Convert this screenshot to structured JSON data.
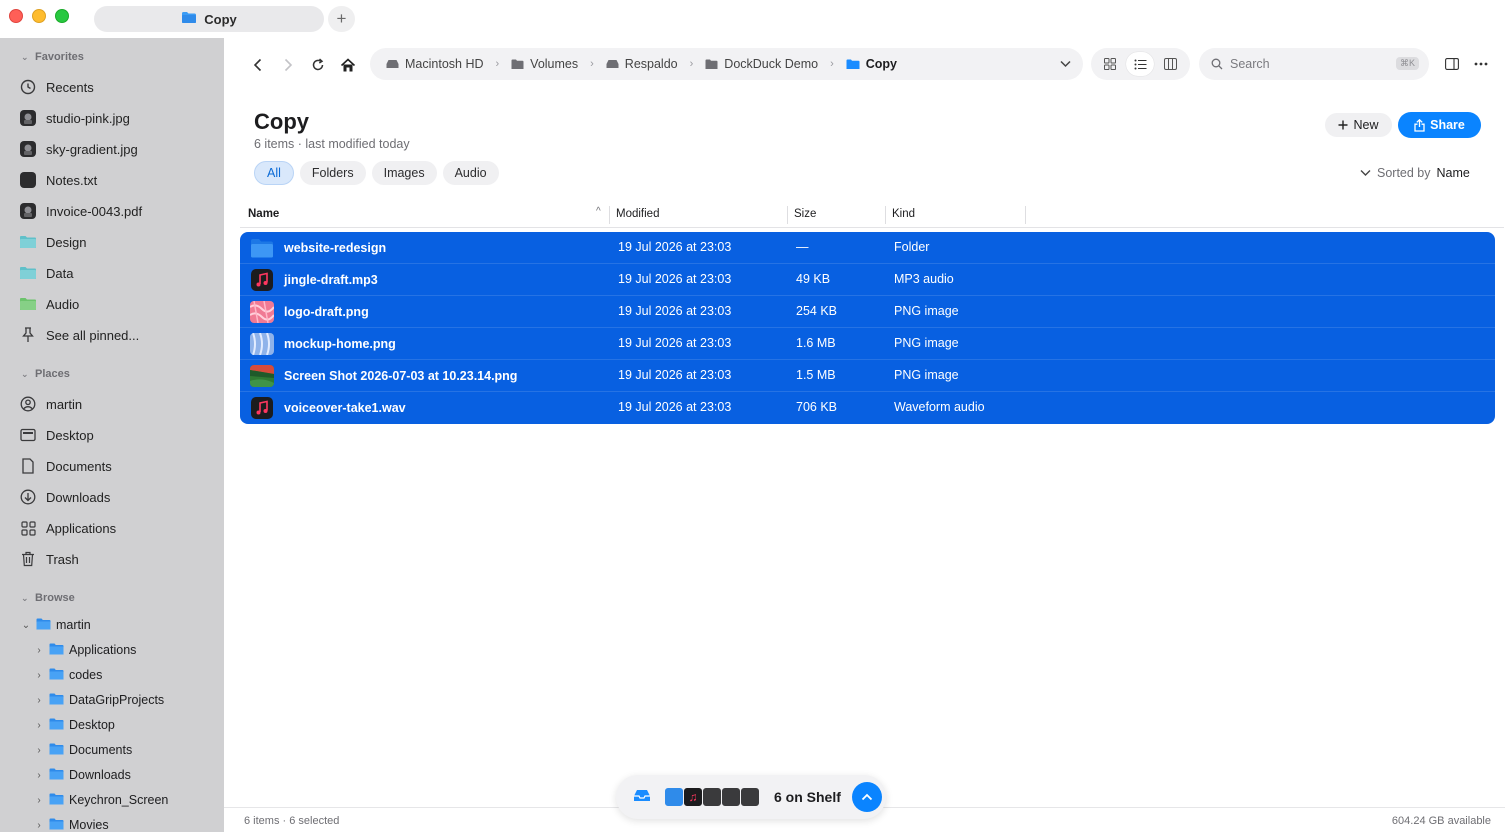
{
  "window": {
    "tab_title": "Copy",
    "new_tab_symbol": "+"
  },
  "sidebar": {
    "favorites_header": "Favorites",
    "favorites": [
      {
        "label": "Recents",
        "icon": "clock-icon"
      },
      {
        "label": "studio-pink.jpg",
        "icon": "image-file-icon"
      },
      {
        "label": "sky-gradient.jpg",
        "icon": "image-file-icon"
      },
      {
        "label": "Notes.txt",
        "icon": "text-file-icon"
      },
      {
        "label": "Invoice-0043.pdf",
        "icon": "pdf-file-icon"
      },
      {
        "label": "Design",
        "icon": "folder-icon"
      },
      {
        "label": "Data",
        "icon": "folder-icon"
      },
      {
        "label": "Audio",
        "icon": "folder-icon"
      },
      {
        "label": "See all pinned...",
        "icon": "pin-icon"
      }
    ],
    "places_header": "Places",
    "places": [
      {
        "label": "martin",
        "icon": "person-icon"
      },
      {
        "label": "Desktop",
        "icon": "desktop-icon"
      },
      {
        "label": "Documents",
        "icon": "document-icon"
      },
      {
        "label": "Downloads",
        "icon": "download-icon"
      },
      {
        "label": "Applications",
        "icon": "apps-grid-icon"
      },
      {
        "label": "Trash",
        "icon": "trash-icon"
      }
    ],
    "browse_header": "Browse",
    "browse_root": "martin",
    "browse_children": [
      "Applications",
      "codes",
      "DataGripProjects",
      "Desktop",
      "Documents",
      "Downloads",
      "Keychron_Screen",
      "Movies"
    ]
  },
  "toolbar": {
    "breadcrumbs": [
      "Macintosh HD",
      "Volumes",
      "Respaldo",
      "DockDuck Demo",
      "Copy"
    ],
    "search_placeholder": "Search",
    "search_shortcut": "⌘K"
  },
  "header": {
    "title": "Copy",
    "subtitle": "6 items · last modified today",
    "new_label": "New",
    "share_label": "Share",
    "filters": [
      "All",
      "Folders",
      "Images",
      "Audio"
    ],
    "active_filter": "All",
    "sorted_prefix": "Sorted by",
    "sorted_value": "Name"
  },
  "table": {
    "columns": [
      "Name",
      "Modified",
      "Size",
      "Kind"
    ],
    "rows": [
      {
        "name": "website-redesign",
        "modified": "19 Jul 2026 at 23:03",
        "size": "—",
        "kind": "Folder",
        "thumb": "folder"
      },
      {
        "name": "jingle-draft.mp3",
        "modified": "19 Jul 2026 at 23:03",
        "size": "49 KB",
        "kind": "MP3 audio",
        "thumb": "music"
      },
      {
        "name": "logo-draft.png",
        "modified": "19 Jul 2026 at 23:03",
        "size": "254 KB",
        "kind": "PNG image",
        "thumb": "pink"
      },
      {
        "name": "mockup-home.png",
        "modified": "19 Jul 2026 at 23:03",
        "size": "1.6 MB",
        "kind": "PNG image",
        "thumb": "blue"
      },
      {
        "name": "Screen Shot 2026-07-03 at 10.23.14.png",
        "modified": "19 Jul 2026 at 23:03",
        "size": "1.5 MB",
        "kind": "PNG image",
        "thumb": "landscape"
      },
      {
        "name": "voiceover-take1.wav",
        "modified": "19 Jul 2026 at 23:03",
        "size": "706 KB",
        "kind": "Waveform audio",
        "thumb": "music"
      }
    ]
  },
  "status": {
    "left": "6 items · 6 selected",
    "right": "604.24 GB available"
  },
  "shelf": {
    "label": "6 on Shelf"
  },
  "colors": {
    "accent": "#0a84ff",
    "selection": "#0860e1",
    "sidebar_bg": "#d0d0d2",
    "folder_blue": "#3b9cf5"
  }
}
